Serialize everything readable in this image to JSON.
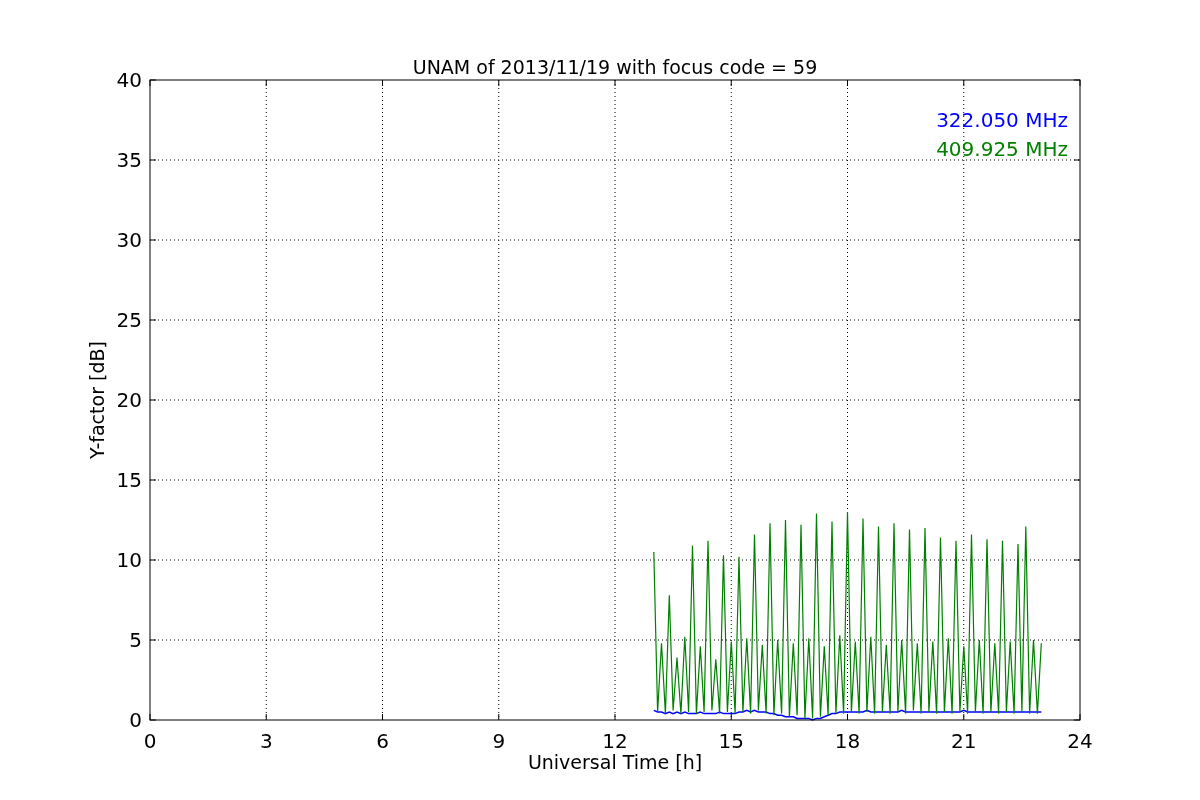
{
  "figure": {
    "chart_data": {
      "type": "line",
      "title": "UNAM of 2013/11/19 with focus code = 59",
      "xlabel": "Universal Time [h]",
      "ylabel": "Y-factor [dB]",
      "grid": true,
      "xlim": [
        0,
        24
      ],
      "ylim": [
        0,
        40
      ],
      "xticks": [
        {
          "value": 0,
          "label": "0"
        },
        {
          "value": 3,
          "label": "3"
        },
        {
          "value": 6,
          "label": "6"
        },
        {
          "value": 9,
          "label": "9"
        },
        {
          "value": 12,
          "label": "12"
        },
        {
          "value": 15,
          "label": "15"
        },
        {
          "value": 18,
          "label": "18"
        },
        {
          "value": 21,
          "label": "21"
        },
        {
          "value": 24,
          "label": "24"
        }
      ],
      "yticks": [
        0,
        5,
        10,
        15,
        20,
        25,
        30,
        35,
        40
      ],
      "x": [
        13.0,
        13.1,
        13.2,
        13.3,
        13.4,
        13.5,
        13.6,
        13.7,
        13.8,
        13.9,
        14.0,
        14.1,
        14.2,
        14.3,
        14.4,
        14.5,
        14.6,
        14.7,
        14.8,
        14.9,
        15.0,
        15.1,
        15.2,
        15.3,
        15.4,
        15.5,
        15.6,
        15.7,
        15.8,
        15.9,
        16.0,
        16.1,
        16.2,
        16.3,
        16.4,
        16.5,
        16.6,
        16.7,
        16.8,
        16.9,
        17.0,
        17.1,
        17.2,
        17.3,
        17.4,
        17.5,
        17.6,
        17.7,
        17.8,
        17.9,
        18.0,
        18.1,
        18.2,
        18.3,
        18.4,
        18.5,
        18.6,
        18.7,
        18.8,
        18.9,
        19.0,
        19.1,
        19.2,
        19.3,
        19.4,
        19.5,
        19.6,
        19.7,
        19.8,
        19.9,
        20.0,
        20.1,
        20.2,
        20.3,
        20.4,
        20.5,
        20.6,
        20.7,
        20.8,
        20.9,
        21.0,
        21.1,
        21.2,
        21.3,
        21.4,
        21.5,
        21.6,
        21.7,
        21.8,
        21.9,
        22.0,
        22.1,
        22.2,
        22.3,
        22.4,
        22.5,
        22.6,
        22.7,
        22.8,
        22.9,
        23.0
      ],
      "series": [
        {
          "name": "322.050 MHz",
          "color": "#0000ff",
          "values": [
            0.6,
            0.5,
            0.5,
            0.4,
            0.5,
            0.4,
            0.5,
            0.4,
            0.5,
            0.4,
            0.4,
            0.4,
            0.5,
            0.4,
            0.4,
            0.4,
            0.4,
            0.5,
            0.4,
            0.4,
            0.4,
            0.4,
            0.5,
            0.5,
            0.6,
            0.5,
            0.6,
            0.5,
            0.5,
            0.5,
            0.4,
            0.4,
            0.3,
            0.3,
            0.2,
            0.2,
            0.2,
            0.1,
            0.1,
            0.1,
            0.1,
            0.0,
            0.1,
            0.1,
            0.2,
            0.3,
            0.4,
            0.4,
            0.5,
            0.5,
            0.5,
            0.5,
            0.5,
            0.5,
            0.5,
            0.6,
            0.5,
            0.5,
            0.5,
            0.5,
            0.5,
            0.5,
            0.5,
            0.5,
            0.6,
            0.5,
            0.5,
            0.5,
            0.5,
            0.5,
            0.5,
            0.5,
            0.5,
            0.5,
            0.5,
            0.5,
            0.5,
            0.5,
            0.5,
            0.5,
            0.6,
            0.5,
            0.5,
            0.5,
            0.5,
            0.5,
            0.5,
            0.5,
            0.5,
            0.5,
            0.5,
            0.5,
            0.5,
            0.5,
            0.5,
            0.5,
            0.5,
            0.5,
            0.5,
            0.5,
            0.5
          ]
        },
        {
          "name": "409.925 MHz",
          "color": "#008000",
          "values": [
            10.5,
            0.5,
            4.8,
            0.4,
            7.8,
            0.6,
            3.9,
            0.4,
            5.2,
            0.5,
            10.9,
            0.4,
            4.6,
            0.5,
            11.2,
            0.6,
            3.8,
            0.4,
            10.3,
            0.5,
            4.9,
            0.4,
            10.2,
            0.5,
            5.1,
            0.4,
            11.6,
            0.6,
            4.7,
            0.4,
            12.3,
            0.3,
            5.0,
            0.4,
            12.5,
            0.2,
            4.8,
            0.3,
            12.2,
            0.1,
            5.1,
            0.1,
            12.9,
            0.2,
            4.6,
            0.3,
            12.4,
            0.4,
            5.3,
            0.4,
            13.0,
            0.5,
            4.9,
            0.4,
            12.6,
            0.5,
            5.2,
            0.4,
            12.1,
            0.5,
            4.7,
            0.4,
            12.3,
            0.5,
            5.0,
            0.4,
            11.9,
            0.6,
            4.8,
            0.4,
            12.0,
            0.5,
            4.9,
            0.4,
            11.4,
            0.5,
            5.1,
            0.4,
            11.2,
            0.5,
            4.6,
            0.4,
            11.6,
            0.5,
            5.0,
            0.4,
            11.3,
            0.5,
            4.8,
            0.4,
            11.2,
            0.5,
            4.9,
            0.4,
            11.0,
            0.5,
            12.1,
            0.4,
            5.0,
            0.4,
            4.8
          ]
        }
      ]
    }
  }
}
